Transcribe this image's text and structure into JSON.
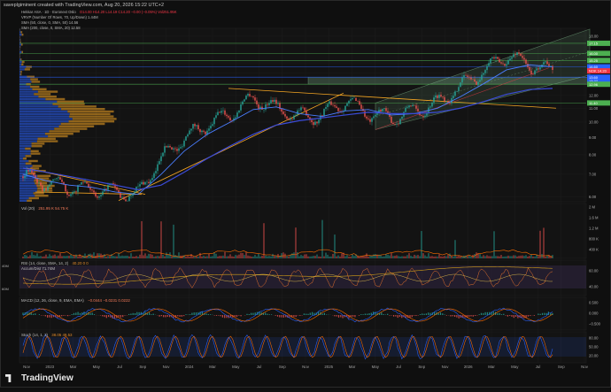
{
  "header": {
    "author_line": "saveplgiminent created with TradingView.com, Aug 20, 2026 15:22 UTC+2"
  },
  "legend": {
    "main": "Hekkar ASA · 1D · Euronext Oslo",
    "main_values": "O14.00 H14.20 L14.19 C14.20 −0.00 (−0.05%) Vol251.95K",
    "vrvp": "VRVP (Number Of Rows, 70, Up/Down) 1.44M",
    "sma50": "SMA (50, close, 0, SMA, 50) 14.56",
    "sma200": "SMA (200, close, 0, SMA, 20) 12.58"
  },
  "price_labels": {
    "markers": [
      {
        "value": "17.15",
        "color": "#4caf50"
      },
      {
        "value": "16.00",
        "color": "#4caf50"
      },
      {
        "value": "15.25",
        "color": "#4caf50"
      },
      {
        "value": "14.60",
        "color": "#2962ff"
      },
      {
        "value": "NOK 14.20",
        "color": "#f23645"
      },
      {
        "value": "13.27",
        "color": "#2962ff"
      },
      {
        "value": "13.60",
        "color": "#2962ff"
      },
      {
        "value": "12.96",
        "color": "#4caf50"
      },
      {
        "value": "11.40",
        "color": "#4caf50"
      }
    ],
    "axis": [
      "18.00",
      "12.00",
      "11.00",
      "10.00",
      "9.00",
      "8.00",
      "7.00",
      "6.00"
    ]
  },
  "panes": {
    "vol": {
      "label": "Vol (20)",
      "values": "251.95 K  54.75 K",
      "axis": [
        "2 M",
        "1.6 M",
        "1.2 M",
        "800 K",
        "400 K"
      ]
    },
    "rsi": {
      "label": "RSI (14, close, SMA, 14, 2)",
      "values": "40.20  0  0",
      "sub": "Accum/Dist  71.74M",
      "axis": [
        "60.00",
        "40.00"
      ],
      "left_axis": [
        "40M",
        "60M"
      ]
    },
    "macd": {
      "label": "MACD (12, 26, close, 9, EMA, EMA)",
      "values": "−0.0444  −0.0231  0.0222",
      "axis": [
        "0.500",
        "0.000",
        "−0.500"
      ]
    },
    "stoch": {
      "label": "Stoch (14, 1, 3)",
      "values": "38.05  49.53",
      "axis": [
        "80.00",
        "50.00",
        "20.00"
      ]
    }
  },
  "time_axis": [
    "Nov",
    "2023",
    "Mar",
    "May",
    "Jul",
    "Sep",
    "Nov",
    "2024",
    "Mar",
    "May",
    "Jul",
    "Sep",
    "Nov",
    "2025",
    "Mar",
    "May",
    "Jul",
    "Sep",
    "Nov",
    "2026",
    "Mar",
    "May",
    "Jul",
    "Sep",
    "Nov"
  ],
  "brand": "TradingView",
  "chart_data": {
    "type": "line",
    "title": "Hekkar ASA · 1D · Euronext Oslo",
    "yaxis_scale": "log",
    "ylim": [
      5.8,
      19
    ],
    "grid": true,
    "x": [
      "2022-11",
      "2023-01",
      "2023-03",
      "2023-05",
      "2023-07",
      "2023-09",
      "2023-11",
      "2024-01",
      "2024-03",
      "2024-05",
      "2024-07",
      "2024-09",
      "2024-11",
      "2025-01",
      "2025-03",
      "2025-05",
      "2025-07",
      "2025-09",
      "2025-11",
      "2026-01",
      "2026-03",
      "2026-05",
      "2026-07",
      "2026-08"
    ],
    "series": [
      {
        "name": "Price",
        "values": [
          6.9,
          6.6,
          6.4,
          6.3,
          6.2,
          6.1,
          7.8,
          9.0,
          9.8,
          10.6,
          11.8,
          11.0,
          10.4,
          10.5,
          11.6,
          10.6,
          10.3,
          10.8,
          11.4,
          12.8,
          14.2,
          15.8,
          14.8,
          14.2
        ]
      },
      {
        "name": "SMA (50, close, 0, SMA, 50)",
        "values": [
          7.0,
          6.7,
          6.5,
          6.4,
          6.2,
          6.1,
          7.0,
          8.2,
          9.2,
          10.0,
          10.9,
          11.1,
          10.6,
          10.4,
          10.8,
          10.9,
          10.5,
          10.6,
          11.0,
          11.9,
          13.0,
          14.3,
          14.8,
          14.6
        ]
      },
      {
        "name": "SMA (200, close, 0, SMA, 20)",
        "values": [
          7.3,
          7.1,
          6.9,
          6.7,
          6.5,
          6.3,
          6.5,
          7.1,
          7.8,
          8.5,
          9.2,
          9.8,
          10.1,
          10.3,
          10.5,
          10.7,
          10.6,
          10.6,
          10.7,
          11.0,
          11.5,
          12.1,
          12.5,
          12.6
        ]
      }
    ],
    "horizontal_levels": [
      17.15,
      16.0,
      15.25,
      12.96,
      11.4
    ],
    "annotations": [
      "Rising channel",
      "Trendlines"
    ]
  }
}
